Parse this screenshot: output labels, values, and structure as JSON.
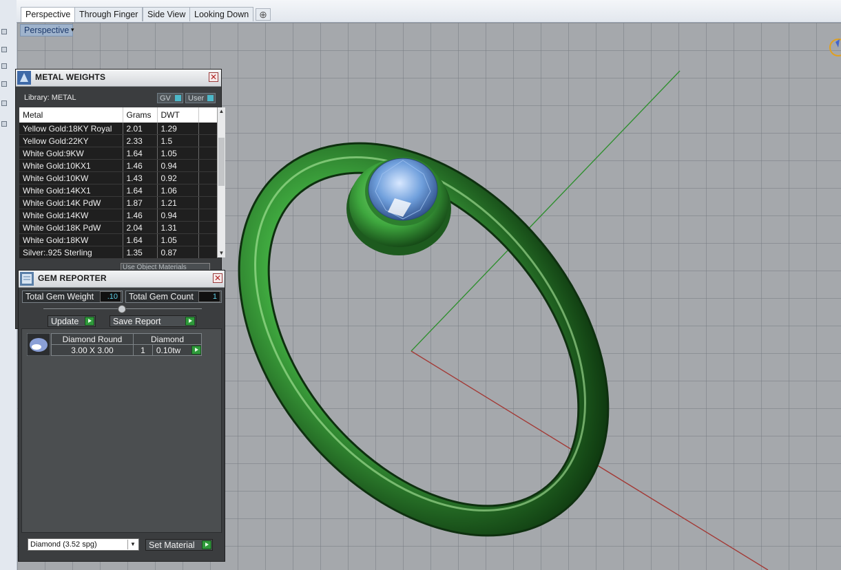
{
  "tabs": [
    {
      "label": "Perspective",
      "active": true
    },
    {
      "label": "Through Finger",
      "active": false
    },
    {
      "label": "Side View",
      "active": false
    },
    {
      "label": "Looking Down",
      "active": false
    }
  ],
  "tab_add_glyph": "⊕",
  "viewport": {
    "label": "Perspective",
    "menu_caret": "▾",
    "ring_color": "#3fa83f",
    "gem_color": "#6f9fdc"
  },
  "metal_weights": {
    "title": "METAL WEIGHTS",
    "library_label": "Library: METAL",
    "toggle_gv": "GV",
    "toggle_user": "User",
    "close_glyph": "✕",
    "columns": [
      "Metal",
      "Grams",
      "DWT"
    ],
    "rows": [
      [
        "Yellow Gold:18KY Royal",
        "2.01",
        "1.29"
      ],
      [
        "Yellow Gold:22KY",
        "2.33",
        "1.5"
      ],
      [
        "White Gold:9KW",
        "1.64",
        "1.05"
      ],
      [
        "White Gold:10KX1",
        "1.46",
        "0.94"
      ],
      [
        "White Gold:10KW",
        "1.43",
        "0.92"
      ],
      [
        "White Gold:14KX1",
        "1.64",
        "1.06"
      ],
      [
        "White Gold:14K PdW",
        "1.87",
        "1.21"
      ],
      [
        "White Gold:14KW",
        "1.46",
        "0.94"
      ],
      [
        "White Gold:18K PdW",
        "2.04",
        "1.31"
      ],
      [
        "White Gold:18KW",
        "1.64",
        "1.05"
      ],
      [
        "Silver:.925 Sterling",
        "1.35",
        "0.87"
      ]
    ],
    "use_object_materials": "Use Object Materials"
  },
  "gem_reporter": {
    "title": "GEM REPORTER",
    "close_glyph": "✕",
    "total_weight_label": "Total Gem Weight",
    "total_weight_value": ".10",
    "total_count_label": "Total Gem Count",
    "total_count_value": "1",
    "update_label": "Update",
    "save_report_label": "Save Report",
    "gem_row": {
      "shape": "Diamond Round",
      "material": "Diamond",
      "size": "3.00 X 3.00",
      "count": "1",
      "weight": "0.10tw"
    },
    "material_select": "Diamond     (3.52 spg)",
    "set_material_label": "Set Material"
  },
  "colors": {
    "panel_bg": "#3b3d3f",
    "accent_green": "#2f9a3b",
    "accent_cyan": "#4cb8c9"
  }
}
